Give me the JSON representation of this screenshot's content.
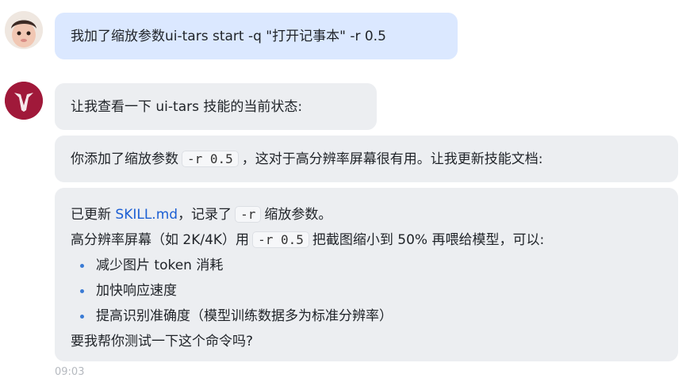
{
  "user_message": {
    "text": "我加了缩放参数ui-tars start -q \"打开记事本\" -r 0.5"
  },
  "assistant_messages": [
    {
      "text": "让我查看一下 ui-tars 技能的当前状态:"
    },
    {
      "pre": "你添加了缩放参数",
      "code": "-r 0.5",
      "post": "，这对于高分辨率屏幕很有用。让我更新技能文档:"
    }
  ],
  "final_message": {
    "line1_pre": "已更新 ",
    "line1_link": "SKILL.md",
    "line1_mid": "，记录了",
    "line1_code": "-r",
    "line1_post": "缩放参数。",
    "line2_pre": "高分辨率屏幕（如 2K/4K）用",
    "line2_code": "-r 0.5",
    "line2_post": "把截图缩小到 50% 再喂给模型，可以:",
    "bullets": [
      "减少图片 token 消耗",
      "加快响应速度",
      "提高识别准确度（模型训练数据多为标准分辨率）"
    ],
    "closing": "要我帮你测试一下这个命令吗?"
  },
  "timestamp": "09:03",
  "colors": {
    "user_bubble": "#dbe8ff",
    "assistant_bubble": "#eceef1",
    "link": "#1c5fd4",
    "bullet": "#3a7bd5",
    "bot_avatar": "#a0193a"
  },
  "icons": {
    "user_avatar": "baby-photo-avatar",
    "bot_avatar": "red-circle-logo-avatar"
  }
}
